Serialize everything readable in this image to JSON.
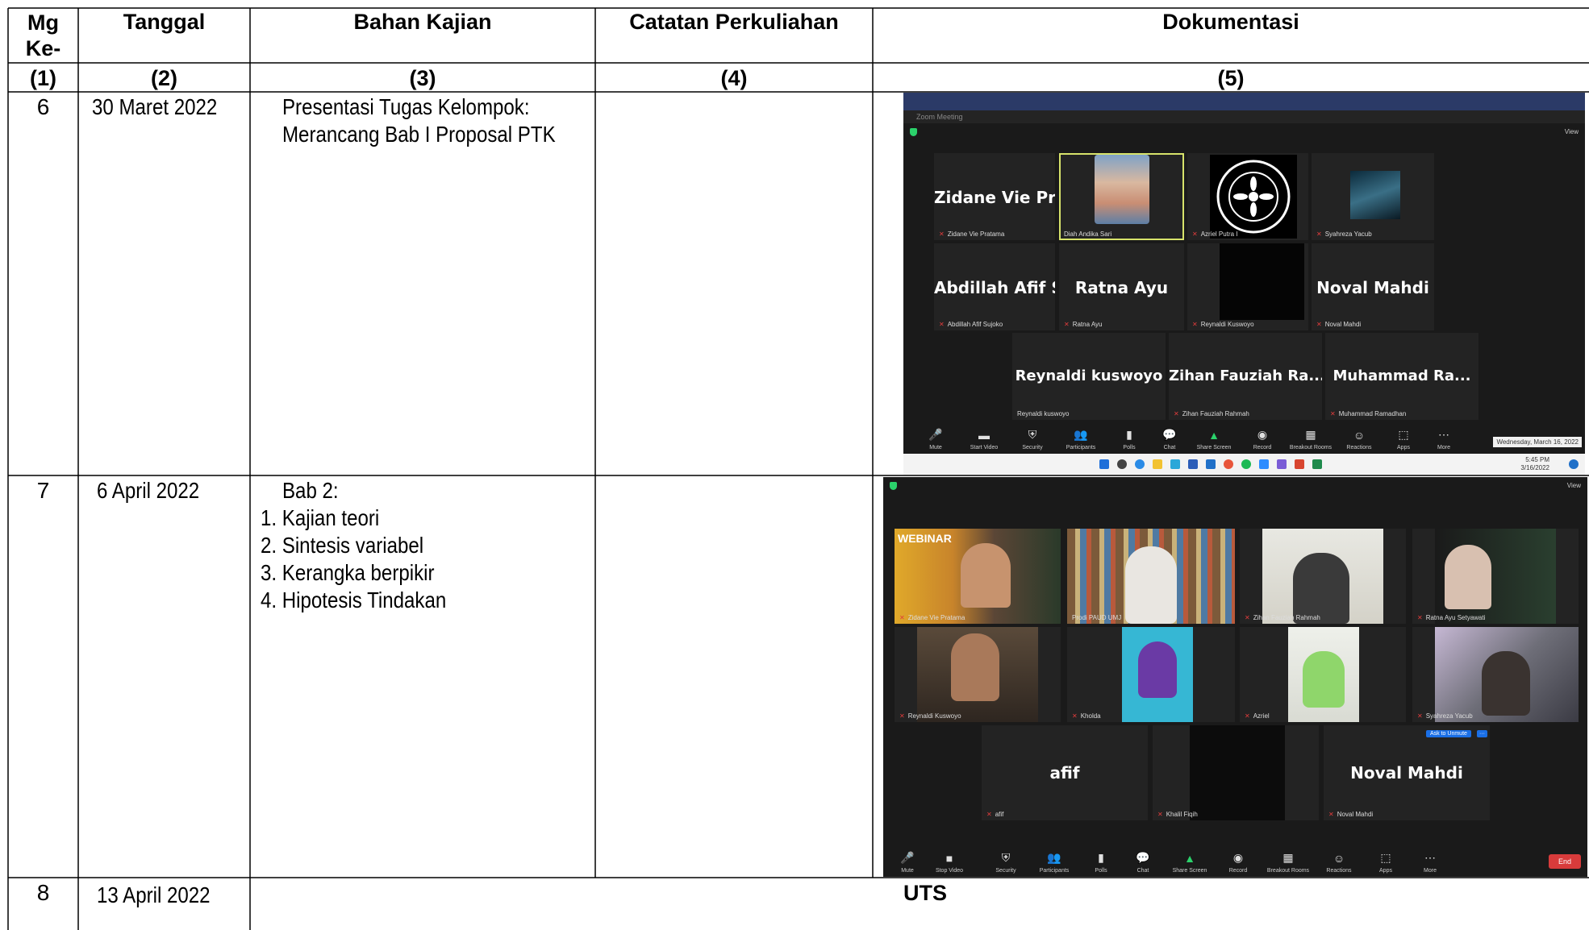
{
  "headers": [
    "Mg Ke-",
    "Tanggal",
    "Bahan Kajian",
    "Catatan Perkuliahan",
    "Dokumentasi"
  ],
  "col_numbers": [
    "(1)",
    "(2)",
    "(3)",
    "(4)",
    "(5)"
  ],
  "rows": [
    {
      "week": "6",
      "date": "30 Maret 2022",
      "material": [
        "Presentasi Tugas Kelompok:",
        "Merancang Bab I Proposal PTK"
      ]
    },
    {
      "week": "7",
      "date": "6 April 2022",
      "material": [
        "Bab 2:",
        "1. Kajian teori",
        "2. Sintesis variabel",
        "3. Kerangka berpikir",
        "4. Hipotesis Tindakan"
      ]
    },
    {
      "week": "8",
      "date": "13 April 2022",
      "material": [
        "UTS"
      ]
    }
  ],
  "zoom1": {
    "window_title": "Zoom Meeting",
    "view_label": "View",
    "tiles": [
      {
        "name": "Zidane Vie Prata...",
        "label": "Zidane Vie Pratama"
      },
      {
        "name": "",
        "label": "Diah Andika Sari"
      },
      {
        "name": "",
        "label": "Azriel Putra I"
      },
      {
        "name": "",
        "label": "Syahreza Yacub"
      },
      {
        "name": "Abdillah Afif Suj...",
        "label": "Abdillah Afif Sujoko"
      },
      {
        "name": "Ratna Ayu",
        "label": "Ratna Ayu"
      },
      {
        "name": "",
        "label": "Reynaldi Kuswoyo"
      },
      {
        "name": "Noval Mahdi",
        "label": "Noval Mahdi"
      },
      {
        "name": "Reynaldi kuswoyo",
        "label": "Reynaldi kuswoyo"
      },
      {
        "name": "Zihan Fauziah Ra...",
        "label": "Zihan Fauziah Rahmah"
      },
      {
        "name": "Muhammad Ra...",
        "label": "Muhammad Ramadhan"
      }
    ],
    "logo_text": "FOREST GREEN ROVERS",
    "toolbar": [
      "Mute",
      "Start Video",
      "Security",
      "Participants",
      "Polls",
      "Chat",
      "Share Screen",
      "Record",
      "Breakout Rooms",
      "Reactions",
      "Apps",
      "More"
    ],
    "date_popup": "Wednesday, March 16, 2022",
    "clock_time": "5:45 PM",
    "clock_date": "3/16/2022"
  },
  "zoom2": {
    "view_label": "View",
    "tiles": [
      {
        "name": "",
        "label": "Zidane Vie Pratama"
      },
      {
        "name": "",
        "label": "Prodi PAUD UMJ"
      },
      {
        "name": "",
        "label": "Zihan Fauziah Rahmah"
      },
      {
        "name": "",
        "label": "Ratna Ayu Setyawati"
      },
      {
        "name": "",
        "label": "Reynaldi Kuswoyo"
      },
      {
        "name": "",
        "label": "Kholda"
      },
      {
        "name": "",
        "label": "Azriel"
      },
      {
        "name": "",
        "label": "Syahreza Yacub"
      },
      {
        "name": "afif",
        "label": "afif"
      },
      {
        "name": "",
        "label": "Khalil Fiqih"
      },
      {
        "name": "Noval Mahdi",
        "label": "Noval Mahdi"
      }
    ],
    "webinar_text": "WEBINAR",
    "unmute_label": "Ask to Unmute",
    "toolbar": [
      "Mute",
      "Stop Video",
      "Security",
      "Participants",
      "Polls",
      "Chat",
      "Share Screen",
      "Record",
      "Breakout Rooms",
      "Reactions",
      "Apps",
      "More"
    ],
    "end_label": "End"
  },
  "colors": {
    "zoom_bg": "#1a1a1a",
    "tile_bg": "#232323",
    "active_border": "#d7e36b",
    "end_red": "#d83b3b",
    "share_green": "#2bd26b"
  }
}
